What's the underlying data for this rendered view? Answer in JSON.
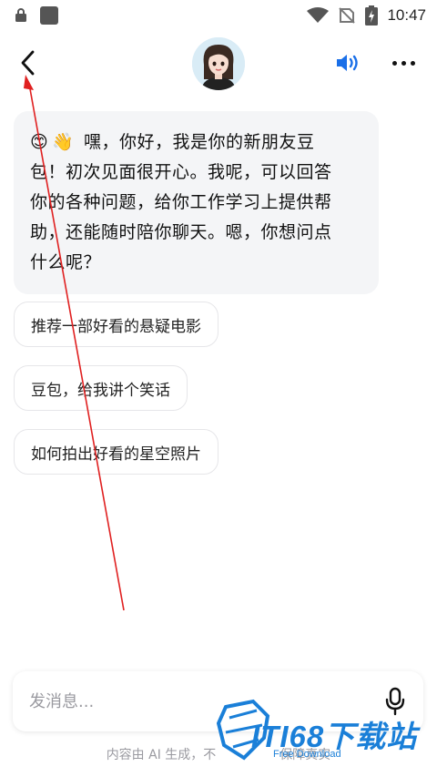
{
  "status_bar": {
    "time": "10:47",
    "icons": [
      "lock-icon",
      "app-square-icon",
      "wifi-icon",
      "no-sim-icon",
      "battery-charging-icon"
    ]
  },
  "header": {
    "back_icon": "chevron-left-icon",
    "avatar": "assistant-avatar",
    "speaker_icon": "speaker-icon",
    "more_icon": "more-dots-icon",
    "accent_color": "#1a6fe8"
  },
  "message": {
    "emojis": [
      "😊",
      "👋"
    ],
    "text": "嘿，你好，我是你的新朋友豆包！初次见面很开心。我呢，可以回答你的各种问题，给你工作学习上提供帮助，还能随时陪你聊天。嗯，你想问点什么呢？",
    "lines": [
      "嘿，你好，我是你的新朋友豆",
      "包！初次见面很开心。我呢，可以回答",
      "你的各种问题，给你工作学习上提供帮",
      "助，还能随时陪你聊天。嗯，你想问点",
      "什么呢？"
    ]
  },
  "suggestions": [
    "推荐一部好看的悬疑电影",
    "豆包，给我讲个笑话",
    "如何拍出好看的星空照片"
  ],
  "input": {
    "placeholder": "发消息...",
    "value": "",
    "mic_icon": "microphone-icon"
  },
  "footer": {
    "note_visible": "内容由 AI 生成，不",
    "note_tail": "保障真实"
  },
  "watermark": {
    "logo_text": "ITI68下载站",
    "sub_text": "Free Download"
  },
  "annotation": {
    "type": "red-arrow",
    "color": "#e02020"
  }
}
